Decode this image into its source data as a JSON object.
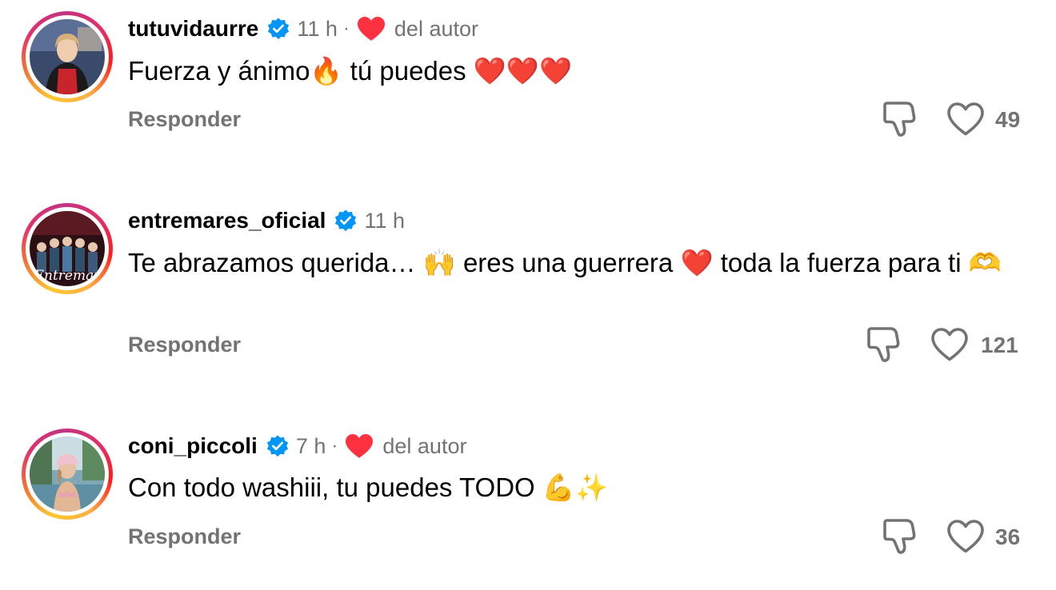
{
  "comments": [
    {
      "username": "tutuvidaurre",
      "time": "11 h",
      "separator": "·",
      "author_label": "del autor",
      "text": "Fuerza y ánimo🔥 tú puedes ❤️❤️❤️",
      "reply_label": "Responder",
      "like_count": "49"
    },
    {
      "username": "entremares_oficial",
      "time": "11 h",
      "text": "Te abrazamos querida… 🙌 eres una guerrera ❤️ toda la fuerza para ti 🫶",
      "avatar_text": "Entremar",
      "reply_label": "Responder",
      "like_count": "121"
    },
    {
      "username": "coni_piccoli",
      "time": "7 h",
      "separator": "·",
      "author_label": "del autor",
      "text": "Con todo washiii, tu puedes TODO 💪✨",
      "reply_label": "Responder",
      "like_count": "36"
    }
  ],
  "colors": {
    "secondary_text": "#737373",
    "verified_blue": "#0095f6",
    "heart_red": "#ff3040",
    "icon_gray": "#737373"
  },
  "icons": {
    "verified": "verified-badge-icon",
    "author_heart": "heart-filled-icon",
    "dislike": "thumb-down-icon",
    "like": "heart-outline-icon"
  }
}
